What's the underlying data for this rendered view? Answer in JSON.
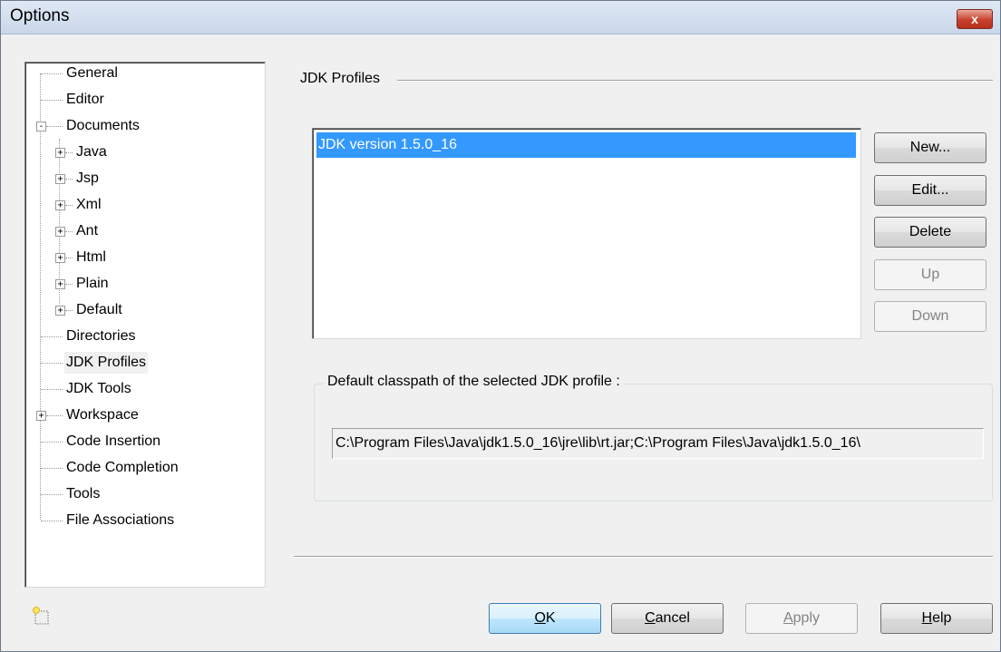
{
  "window": {
    "title": "Options",
    "close_glyph": "x"
  },
  "tree": {
    "items": [
      {
        "label": "General",
        "level": 0,
        "expander": ""
      },
      {
        "label": "Editor",
        "level": 0,
        "expander": ""
      },
      {
        "label": "Documents",
        "level": 0,
        "expander": "-"
      },
      {
        "label": "Java",
        "level": 1,
        "expander": "+"
      },
      {
        "label": "Jsp",
        "level": 1,
        "expander": "+"
      },
      {
        "label": "Xml",
        "level": 1,
        "expander": "+"
      },
      {
        "label": "Ant",
        "level": 1,
        "expander": "+"
      },
      {
        "label": "Html",
        "level": 1,
        "expander": "+"
      },
      {
        "label": "Plain",
        "level": 1,
        "expander": "+"
      },
      {
        "label": "Default",
        "level": 1,
        "expander": "+"
      },
      {
        "label": "Directories",
        "level": 0,
        "expander": ""
      },
      {
        "label": "JDK Profiles",
        "level": 0,
        "expander": "",
        "selected": true
      },
      {
        "label": "JDK Tools",
        "level": 0,
        "expander": ""
      },
      {
        "label": "Workspace",
        "level": 0,
        "expander": "+"
      },
      {
        "label": "Code Insertion",
        "level": 0,
        "expander": ""
      },
      {
        "label": "Code Completion",
        "level": 0,
        "expander": ""
      },
      {
        "label": "Tools",
        "level": 0,
        "expander": ""
      },
      {
        "label": "File Associations",
        "level": 0,
        "expander": ""
      }
    ]
  },
  "panel": {
    "section_title": "JDK Profiles",
    "profiles": [
      "JDK version 1.5.0_16"
    ],
    "buttons": {
      "new": "New...",
      "edit": "Edit...",
      "delete": "Delete",
      "up": "Up",
      "down": "Down"
    },
    "classpath_group_label": "Default classpath of the selected JDK profile :",
    "classpath_value": "C:\\Program Files\\Java\\jdk1.5.0_16\\jre\\lib\\rt.jar;C:\\Program Files\\Java\\jdk1.5.0_16\\"
  },
  "footer": {
    "ok_mnemonic": "O",
    "ok_rest": "K",
    "cancel_mnemonic": "C",
    "cancel_rest": "ancel",
    "apply_mnemonic": "A",
    "apply_rest": "pply",
    "help_mnemonic": "H",
    "help_rest": "elp",
    "new_item_icon": "new-item-icon"
  },
  "colors": {
    "selection": "#3399ff",
    "close_button": "#c7412c",
    "window_bg": "#f0f0f0"
  }
}
